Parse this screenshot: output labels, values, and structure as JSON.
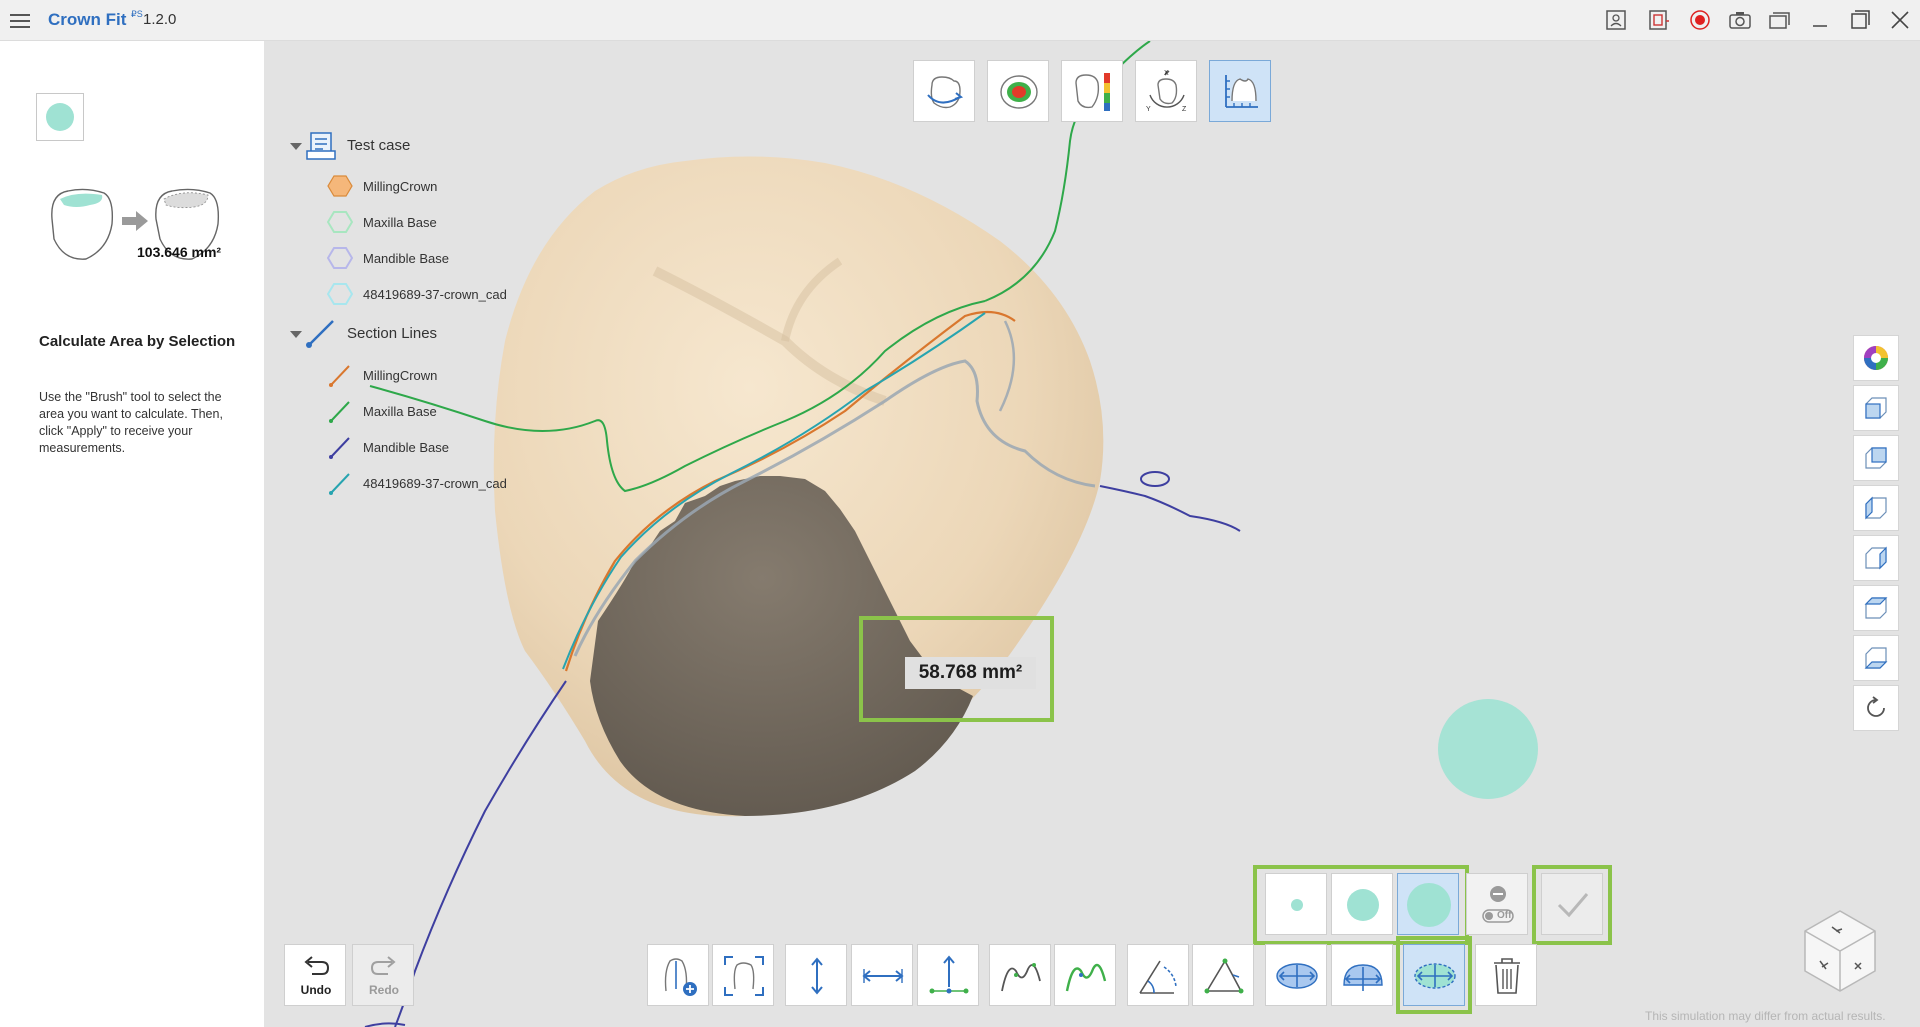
{
  "app": {
    "name": "Crown Fit",
    "badge": "₽S",
    "version": "1.2.0"
  },
  "titlebar": {
    "icons": [
      "report-icon",
      "export-icon",
      "record-icon",
      "camera-icon",
      "gallery-icon",
      "minimize-icon",
      "maximize-icon",
      "close-icon"
    ]
  },
  "left_panel": {
    "brush_swatch_color": "#9fe2d3",
    "total_area": "103.646 mm²",
    "title": "Calculate Area by Selection",
    "description": "Use the \"Brush\" tool to select the area you want to calculate. Then, click \"Apply\" to receive your measurements."
  },
  "view_toolbar": {
    "buttons": [
      "rotate-view-icon",
      "occlusion-map-icon",
      "color-scale-icon",
      "axis-orientation-icon",
      "measure-tool-icon"
    ],
    "active_index": 4
  },
  "tree": {
    "group1": {
      "label": "Test case",
      "items": [
        {
          "label": "MillingCrown",
          "color": "#f5b77a"
        },
        {
          "label": "Maxilla Base",
          "color": "#a8e6c0"
        },
        {
          "label": "Mandible Base",
          "color": "#b7b7ea"
        },
        {
          "label": "48419689-37-crown_cad",
          "color": "#a8e6ee"
        }
      ]
    },
    "group2": {
      "label": "Section Lines",
      "items": [
        {
          "label": "MillingCrown",
          "color": "#d9772e"
        },
        {
          "label": "Maxilla Base",
          "color": "#2ea84a"
        },
        {
          "label": "Mandible Base",
          "color": "#3e3fa0"
        },
        {
          "label": "48419689-37-crown_cad",
          "color": "#27a4b0"
        }
      ]
    }
  },
  "measurement": {
    "selected_area": "58.768 mm²"
  },
  "brush_sizes": {
    "options": [
      "small",
      "medium",
      "large"
    ],
    "active": "large",
    "eraser_toggle_label": "Off",
    "apply_label": "Apply"
  },
  "bottom_toolbar": {
    "undo_label": "Undo",
    "redo_label": "Redo",
    "tools": [
      "add-margin-icon",
      "fit-frame-icon",
      "vertical-distance-icon",
      "horizontal-distance-icon",
      "point-distance-icon",
      "curve-icon",
      "curve-fill-icon",
      "angle-icon",
      "triangle-angle-icon",
      "area-ellipse-icon",
      "area-brush-icon",
      "area-select-icon",
      "trash-icon"
    ],
    "active_index": 11
  },
  "right_toolbar": {
    "buttons": [
      "color-wheel-icon",
      "front-view-icon",
      "back-view-icon",
      "left-view-icon",
      "right-view-icon",
      "top-view-icon",
      "bottom-view-icon",
      "reset-view-icon"
    ]
  },
  "footer_note": "This simulation may differ from actual results.",
  "colors": {
    "accent": "#2f6fc0",
    "highlight": "#8bc34a",
    "brush": "#9fe2d3",
    "tooth": "#efdcc0",
    "selection": "#736a5e"
  }
}
